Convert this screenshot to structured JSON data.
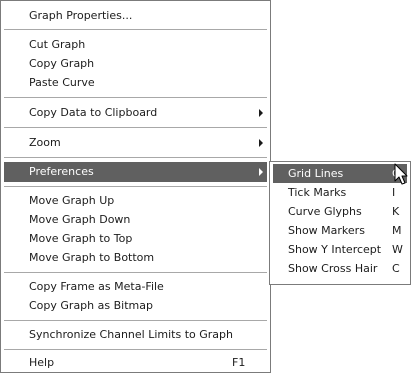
{
  "menu": {
    "items": [
      {
        "label": "Graph Properties..."
      },
      {
        "label": "Cut Graph"
      },
      {
        "label": "Copy Graph"
      },
      {
        "label": "Paste Curve"
      },
      {
        "label": "Copy Data to Clipboard"
      },
      {
        "label": "Zoom"
      },
      {
        "label": "Preferences"
      },
      {
        "label": "Move Graph Up"
      },
      {
        "label": "Move Graph Down"
      },
      {
        "label": "Move Graph to Top"
      },
      {
        "label": "Move Graph to Bottom"
      },
      {
        "label": "Copy Frame as Meta-File"
      },
      {
        "label": "Copy Graph as Bitmap"
      },
      {
        "label": "Synchronize Channel Limits to Graph"
      },
      {
        "label": "Help",
        "shortcut": "F1"
      }
    ]
  },
  "submenu": {
    "parent": "Preferences",
    "items": [
      {
        "label": "Grid Lines",
        "shortcut": "G"
      },
      {
        "label": "Tick Marks",
        "shortcut": "I"
      },
      {
        "label": "Curve Glyphs",
        "shortcut": "K"
      },
      {
        "label": "Show Markers",
        "shortcut": "M"
      },
      {
        "label": "Show Y Intercept",
        "shortcut": "W"
      },
      {
        "label": "Show Cross Hair",
        "shortcut": "C"
      }
    ]
  },
  "colors": {
    "highlight": "#606060",
    "highlight_text": "#ffffff",
    "border": "#7b7b7b",
    "separator": "#a8a8a8"
  },
  "icons": {
    "submenu_arrow": "chevron-right-icon",
    "cursor": "mouse-pointer-icon"
  }
}
